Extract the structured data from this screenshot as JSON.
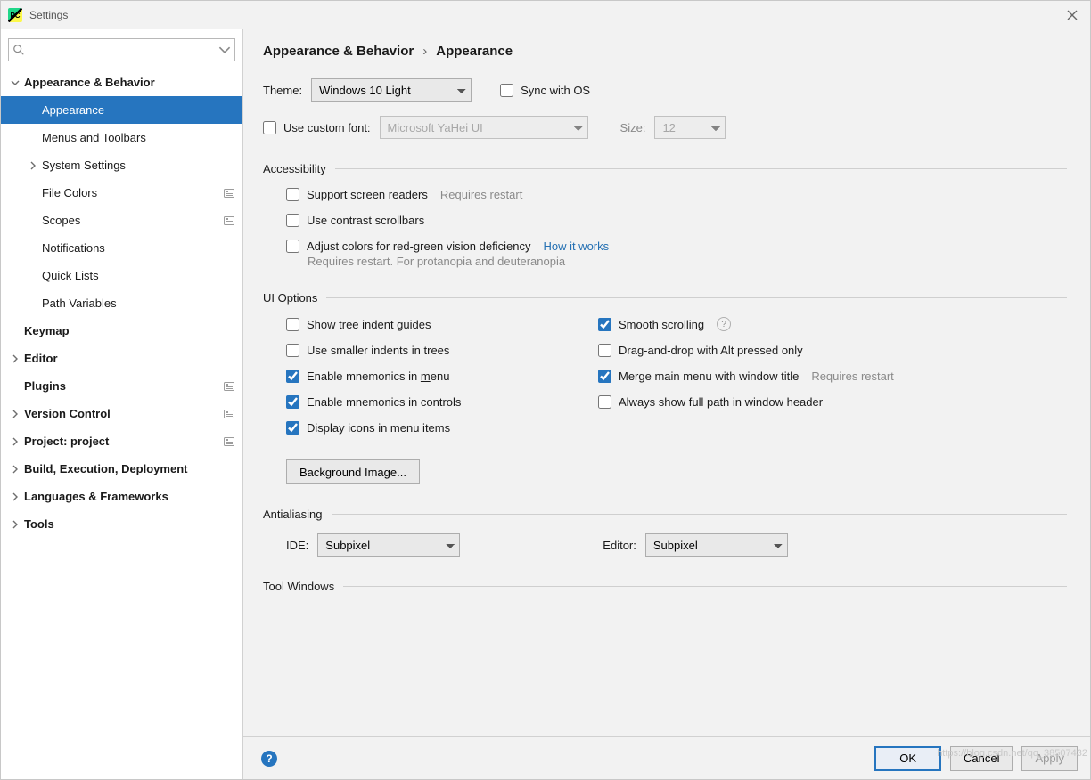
{
  "window": {
    "title": "Settings"
  },
  "search": {
    "placeholder": ""
  },
  "sidebar": {
    "items": [
      {
        "label": "Appearance & Behavior",
        "depth": 0,
        "bold": true,
        "expanded": true,
        "hasChildren": true
      },
      {
        "label": "Appearance",
        "depth": 1,
        "selected": true
      },
      {
        "label": "Menus and Toolbars",
        "depth": 1
      },
      {
        "label": "System Settings",
        "depth": 1,
        "hasChildren": true,
        "expanded": false
      },
      {
        "label": "File Colors",
        "depth": 1,
        "projectBadge": true
      },
      {
        "label": "Scopes",
        "depth": 1,
        "projectBadge": true
      },
      {
        "label": "Notifications",
        "depth": 1
      },
      {
        "label": "Quick Lists",
        "depth": 1
      },
      {
        "label": "Path Variables",
        "depth": 1
      },
      {
        "label": "Keymap",
        "depth": 0,
        "bold": true
      },
      {
        "label": "Editor",
        "depth": 0,
        "bold": true,
        "hasChildren": true,
        "expanded": false
      },
      {
        "label": "Plugins",
        "depth": 0,
        "bold": true,
        "projectBadge": true
      },
      {
        "label": "Version Control",
        "depth": 0,
        "bold": true,
        "hasChildren": true,
        "expanded": false,
        "projectBadge": true
      },
      {
        "label": "Project: project",
        "depth": 0,
        "bold": true,
        "hasChildren": true,
        "expanded": false,
        "projectBadge": true
      },
      {
        "label": "Build, Execution, Deployment",
        "depth": 0,
        "bold": true,
        "hasChildren": true,
        "expanded": false
      },
      {
        "label": "Languages & Frameworks",
        "depth": 0,
        "bold": true,
        "hasChildren": true,
        "expanded": false
      },
      {
        "label": "Tools",
        "depth": 0,
        "bold": true,
        "hasChildren": true,
        "expanded": false
      }
    ]
  },
  "breadcrumb": {
    "parent": "Appearance & Behavior",
    "current": "Appearance"
  },
  "theme": {
    "label": "Theme:",
    "value": "Windows 10 Light",
    "sync_label": "Sync with OS",
    "sync_checked": false
  },
  "font": {
    "use_label": "Use custom font:",
    "use_checked": false,
    "family": "Microsoft YaHei UI",
    "size_label": "Size:",
    "size": "12"
  },
  "sections": {
    "accessibility": "Accessibility",
    "ui_options": "UI Options",
    "antialiasing": "Antialiasing",
    "tool_windows": "Tool Windows"
  },
  "accessibility": {
    "screen_readers": {
      "label": "Support screen readers",
      "checked": false,
      "hint": "Requires restart"
    },
    "contrast_scroll": {
      "label": "Use contrast scrollbars",
      "checked": false
    },
    "adjust_colors": {
      "label": "Adjust colors for red-green vision deficiency",
      "checked": false,
      "link": "How it works",
      "sub": "Requires restart. For protanopia and deuteranopia"
    }
  },
  "ui": {
    "left": [
      {
        "key": "tree_indent",
        "label": "Show tree indent guides",
        "checked": false
      },
      {
        "key": "small_indents",
        "label": "Use smaller indents in trees",
        "checked": false
      },
      {
        "key": "mnemonics_menu",
        "label": "Enable mnemonics in menu",
        "checked": true,
        "underline": "m"
      },
      {
        "key": "mnemonics_ctrl",
        "label": "Enable mnemonics in controls",
        "checked": true
      },
      {
        "key": "icons_menu",
        "label": "Display icons in menu items",
        "checked": true
      }
    ],
    "right": [
      {
        "key": "smooth",
        "label": "Smooth scrolling",
        "checked": true,
        "help": true
      },
      {
        "key": "dnd_alt",
        "label": "Drag-and-drop with Alt pressed only",
        "checked": false
      },
      {
        "key": "merge_menu",
        "label": "Merge main menu with window title",
        "checked": true,
        "hint": "Requires restart"
      },
      {
        "key": "full_path",
        "label": "Always show full path in window header",
        "checked": false
      }
    ],
    "bg_image_btn": "Background Image..."
  },
  "antialiasing": {
    "ide_label": "IDE:",
    "ide_value": "Subpixel",
    "editor_label": "Editor:",
    "editor_value": "Subpixel"
  },
  "buttons": {
    "ok": "OK",
    "cancel": "Cancel",
    "apply": "Apply"
  },
  "watermark": "https://blog.csdn.net/qq_38507432"
}
